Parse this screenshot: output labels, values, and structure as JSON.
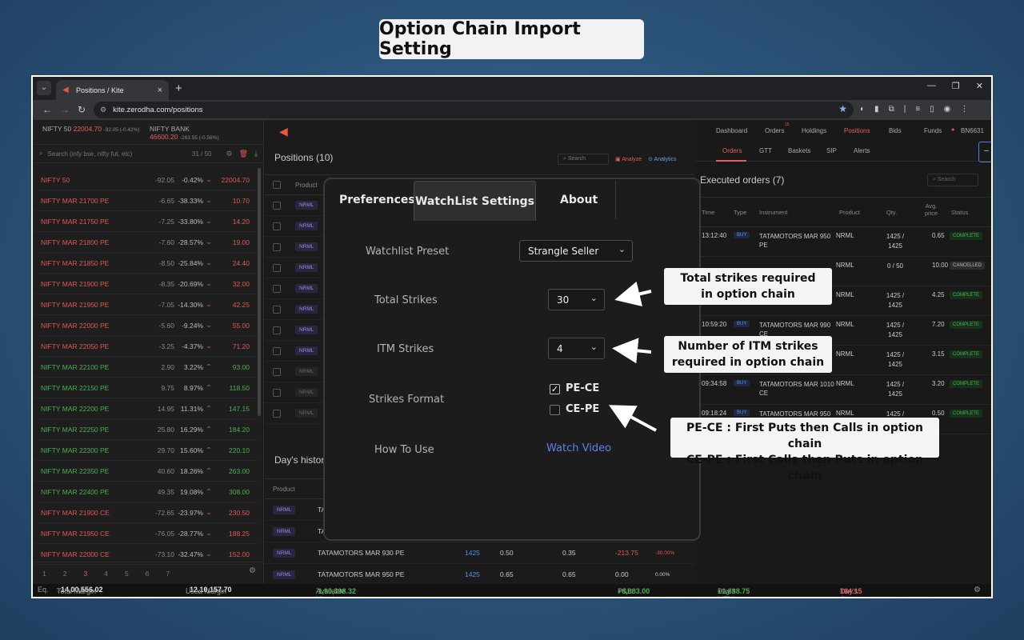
{
  "banner": {
    "title": "Option Chain Import Setting"
  },
  "browser": {
    "tab_title": "Positions / Kite",
    "url": "kite.zerodha.com/positions",
    "tab_close": "×",
    "new_tab": "+"
  },
  "indices": [
    {
      "name": "NIFTY 50",
      "value": "22004.70",
      "change": "-92.05 (-0.42%)"
    },
    {
      "name": "NIFTY BANK",
      "value": "46600.20",
      "change": "-263.55 (-0.56%)"
    }
  ],
  "watchlist": {
    "search_placeholder": "Search (infy bse, nifty fut, etc)",
    "count": "31 / 50",
    "items": [
      {
        "name": "NIFTY 50",
        "change": "-92.05",
        "pct": "-0.42%",
        "dir": "down",
        "ltp": "22004.70",
        "color": "red"
      },
      {
        "name": "NIFTY MAR 21700 PE",
        "change": "-6.65",
        "pct": "-38.33%",
        "dir": "down",
        "ltp": "10.70",
        "color": "red"
      },
      {
        "name": "NIFTY MAR 21750 PE",
        "change": "-7.25",
        "pct": "-33.80%",
        "dir": "down",
        "ltp": "14.20",
        "color": "red"
      },
      {
        "name": "NIFTY MAR 21800 PE",
        "change": "-7.60",
        "pct": "-28.57%",
        "dir": "down",
        "ltp": "19.00",
        "color": "red"
      },
      {
        "name": "NIFTY MAR 21850 PE",
        "change": "-8.50",
        "pct": "-25.84%",
        "dir": "down",
        "ltp": "24.40",
        "color": "red"
      },
      {
        "name": "NIFTY MAR 21900 PE",
        "change": "-8.35",
        "pct": "-20.69%",
        "dir": "down",
        "ltp": "32.00",
        "color": "red"
      },
      {
        "name": "NIFTY MAR 21950 PE",
        "change": "-7.05",
        "pct": "-14.30%",
        "dir": "down",
        "ltp": "42.25",
        "color": "red"
      },
      {
        "name": "NIFTY MAR 22000 PE",
        "change": "-5.60",
        "pct": "-9.24%",
        "dir": "down",
        "ltp": "55.00",
        "color": "red"
      },
      {
        "name": "NIFTY MAR 22050 PE",
        "change": "-3.25",
        "pct": "-4.37%",
        "dir": "down",
        "ltp": "71.20",
        "color": "red"
      },
      {
        "name": "NIFTY MAR 22100 PE",
        "change": "2.90",
        "pct": "3.22%",
        "dir": "up",
        "ltp": "93.00",
        "color": "green"
      },
      {
        "name": "NIFTY MAR 22150 PE",
        "change": "9.75",
        "pct": "8.97%",
        "dir": "up",
        "ltp": "118.50",
        "color": "green"
      },
      {
        "name": "NIFTY MAR 22200 PE",
        "change": "14.95",
        "pct": "11.31%",
        "dir": "up",
        "ltp": "147.15",
        "color": "green"
      },
      {
        "name": "NIFTY MAR 22250 PE",
        "change": "25.80",
        "pct": "16.29%",
        "dir": "up",
        "ltp": "184.20",
        "color": "green"
      },
      {
        "name": "NIFTY MAR 22300 PE",
        "change": "29.70",
        "pct": "15.60%",
        "dir": "up",
        "ltp": "220.10",
        "color": "green"
      },
      {
        "name": "NIFTY MAR 22350 PE",
        "change": "40.60",
        "pct": "18.26%",
        "dir": "up",
        "ltp": "263.00",
        "color": "green"
      },
      {
        "name": "NIFTY MAR 22400 PE",
        "change": "49.35",
        "pct": "19.08%",
        "dir": "up",
        "ltp": "308.00",
        "color": "green"
      },
      {
        "name": "NIFTY MAR 21900 CE",
        "change": "-72.65",
        "pct": "-23.97%",
        "dir": "down",
        "ltp": "230.50",
        "color": "red"
      },
      {
        "name": "NIFTY MAR 21950 CE",
        "change": "-76.05",
        "pct": "-28.77%",
        "dir": "down",
        "ltp": "188.25",
        "color": "red"
      },
      {
        "name": "NIFTY MAR 22000 CE",
        "change": "-73.10",
        "pct": "-32.47%",
        "dir": "down",
        "ltp": "152.00",
        "color": "red"
      }
    ],
    "pages": [
      "1",
      "2",
      "3",
      "4",
      "5",
      "6",
      "7"
    ],
    "active_page": "3"
  },
  "positions": {
    "title": "Positions (10)",
    "search_placeholder": "Search",
    "analyze_label": "Analyze",
    "analytics_label": "Analytics",
    "header_product": "Product",
    "product_tag": "NRML"
  },
  "history": {
    "title": "Day's histor",
    "header_product": "Product",
    "header_instrument": "I",
    "product_tag": "NRML",
    "row_prefix": "TA",
    "rows": [
      {
        "instrument": "TATAMOTORS MAR 930 PE",
        "qty": "1425",
        "buy": "0.50",
        "sell": "0.35",
        "pnl": "-213.75",
        "pct": "-30.00%"
      },
      {
        "instrument": "TATAMOTORS MAR 950 PE",
        "qty": "1425",
        "buy": "0.65",
        "sell": "0.65",
        "pnl": "0.00",
        "pct": "0.00%"
      }
    ]
  },
  "topnav": {
    "items": [
      "Dashboard",
      "Orders",
      "Holdings",
      "Positions",
      "Bids",
      "Funds"
    ],
    "active": "Positions",
    "orders_badge": "15",
    "user_id": "BN6631"
  },
  "subtabs": {
    "items": [
      "Orders",
      "GTT",
      "Baskets",
      "SIP",
      "Alerts"
    ],
    "active": "Orders"
  },
  "orders": {
    "title": "Executed orders (7)",
    "search_placeholder": "Search",
    "headers": {
      "time": "Time",
      "type": "Type",
      "instrument": "Instrument",
      "product": "Product",
      "qty": "Qty.",
      "avg": "Avg. price",
      "status": "Status"
    },
    "rows": [
      {
        "time": "13:12:40",
        "type": "BUY",
        "instrument": "TATAMOTORS MAR 950 PE",
        "product": "NRML",
        "qty": "1425 / 1425",
        "avg": "0.65",
        "status": "COMPLETE"
      },
      {
        "time": "",
        "type": "",
        "instrument": "",
        "product": "NRML",
        "qty": "0 / 50",
        "avg": "10.00",
        "status": "CANCELLED"
      },
      {
        "time": "",
        "type": "",
        "instrument": "",
        "product": "NRML",
        "qty": "1425 / 1425",
        "avg": "4.25",
        "status": "COMPLETE"
      },
      {
        "time": "10:59:20",
        "type": "BUY",
        "instrument": "TATAMOTORS MAR 990 CE",
        "product": "NRML",
        "qty": "1425 / 1425",
        "avg": "7.20",
        "status": "COMPLETE"
      },
      {
        "time": "",
        "type": "",
        "instrument": "",
        "product": "NRML",
        "qty": "1425 / 1425",
        "avg": "3.15",
        "status": "COMPLETE"
      },
      {
        "time": "09:34:58",
        "type": "BUY",
        "instrument": "TATAMOTORS MAR 1010 CE",
        "product": "NRML",
        "qty": "1425 / 1425",
        "avg": "3.20",
        "status": "COMPLETE"
      },
      {
        "time": "09:18:24",
        "type": "BUY",
        "instrument": "TATAMOTORS MAR 950 PE",
        "product": "NRML",
        "qty": "1425 / 1425",
        "avg": "0.50",
        "status": "COMPLETE"
      }
    ]
  },
  "bottom": {
    "eq_label": "Eq.",
    "total_margin_label": "Total Margin",
    "total_margin": "14,00,556.02",
    "used_margin_label": "Used Margin",
    "used_margin": "12,10,157.70",
    "available_margin_label": "Available Margin",
    "available_margin": "1,90,398.32",
    "pnl_label": "P&L:",
    "pnl": "+6,883.00",
    "mtm_label": "Day's MTM:",
    "mtm": "+1,638.75",
    "charges_label": "Day's Charges:",
    "charges": "164.15"
  },
  "modal": {
    "tabs": [
      "Preferences",
      "WatchList Settings",
      "About"
    ],
    "active_tab": "WatchList Settings",
    "preset_label": "Watchlist Preset",
    "preset_value": "Strangle Seller",
    "total_strikes_label": "Total Strikes",
    "total_strikes_value": "30",
    "itm_strikes_label": "ITM Strikes",
    "itm_strikes_value": "4",
    "format_label": "Strikes Format",
    "format_options": [
      {
        "label": "PE-CE",
        "checked": true
      },
      {
        "label": "CE-PE",
        "checked": false
      }
    ],
    "how_to_label": "How To Use",
    "watch_video_link": "Watch Video"
  },
  "callouts": {
    "total_line1": "Total strikes required",
    "total_line2": "in option chain",
    "itm_line1": "Number of ITM strikes",
    "itm_line2": "required in option chain",
    "format_line1": "PE-CE : First Puts then Calls in option chain",
    "format_line2": "CE-PE : First Calls then Puts in option chain"
  },
  "colors": {
    "accent_red": "#df5a55",
    "positive_green": "#4caf50",
    "link_blue": "#5d83ea"
  }
}
